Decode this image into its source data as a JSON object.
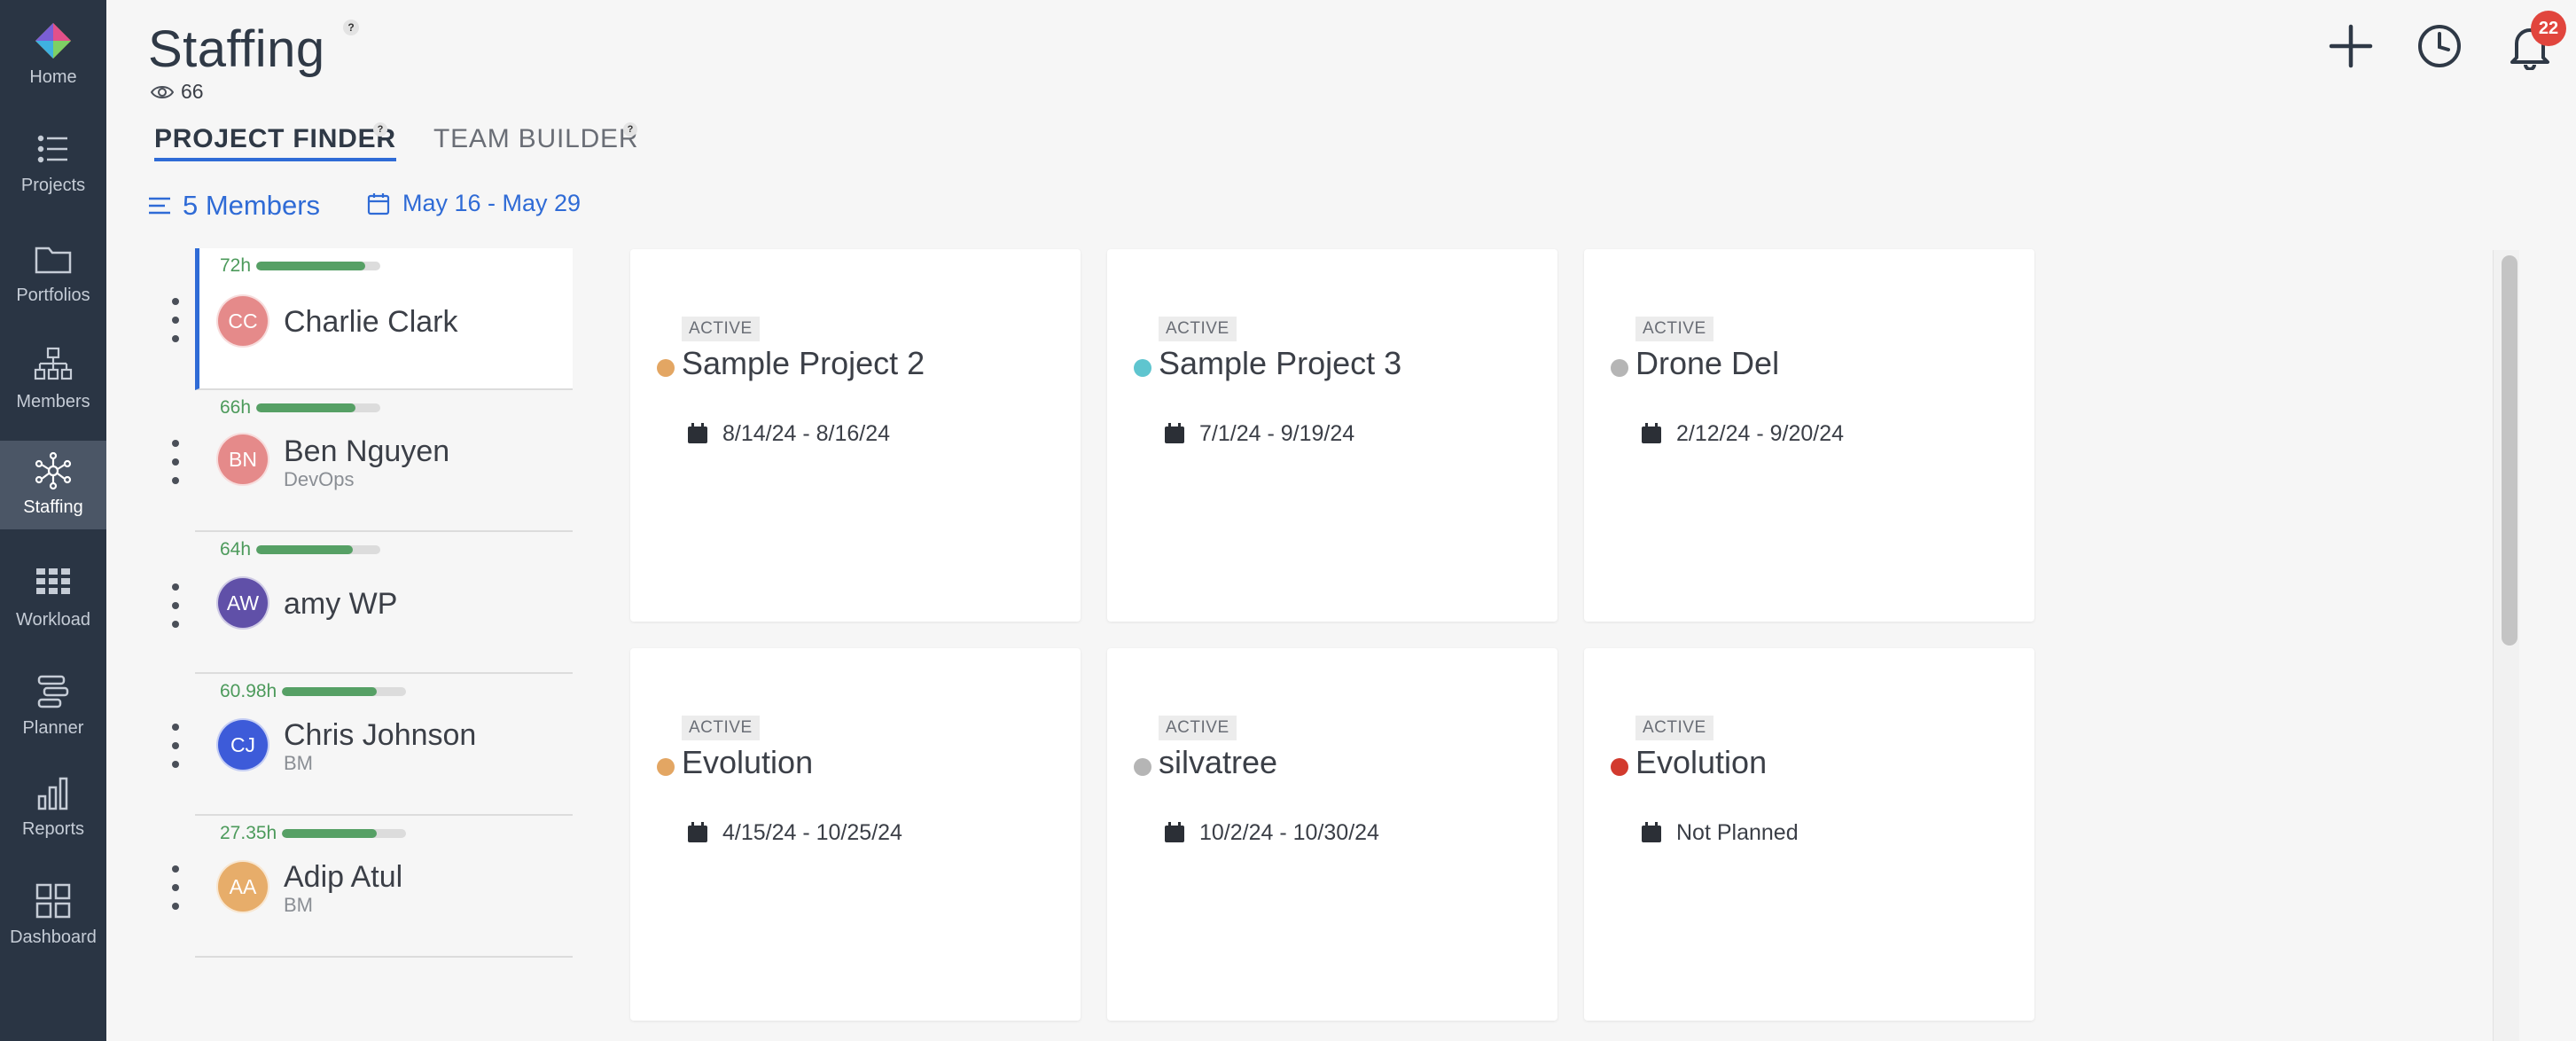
{
  "nav": {
    "items": [
      {
        "label": "Home",
        "icon": "home-logo-icon"
      },
      {
        "label": "Projects",
        "icon": "list-icon"
      },
      {
        "label": "Portfolios",
        "icon": "folder-icon"
      },
      {
        "label": "Members",
        "icon": "org-chart-icon"
      },
      {
        "label": "Staffing",
        "icon": "network-icon",
        "active": true
      },
      {
        "label": "Workload",
        "icon": "grid-icon"
      },
      {
        "label": "Planner",
        "icon": "planner-icon"
      },
      {
        "label": "Reports",
        "icon": "bar-chart-icon"
      },
      {
        "label": "Dashboard",
        "icon": "dashboard-icon"
      }
    ]
  },
  "header": {
    "title": "Staffing",
    "help": "?",
    "views_count": "66",
    "notification_count": "22"
  },
  "tabs": [
    {
      "label": "PROJECT FINDER",
      "help": "?",
      "active": true
    },
    {
      "label": "TEAM BUILDER",
      "help": "?",
      "active": false
    }
  ],
  "filters": {
    "members_label": "5 Members",
    "date_range": "May 16 - May 29"
  },
  "members": [
    {
      "initials": "CC",
      "name": "Charlie Clark",
      "role": "",
      "hours": "72h",
      "fill": 0.88,
      "avatar_color": "#e58a8a",
      "selected": true
    },
    {
      "initials": "BN",
      "name": "Ben Nguyen",
      "role": "DevOps",
      "hours": "66h",
      "fill": 0.8,
      "avatar_color": "#e58a8a",
      "selected": false
    },
    {
      "initials": "AW",
      "name": "amy WP",
      "role": "",
      "hours": "64h",
      "fill": 0.78,
      "avatar_color": "#6050a8",
      "selected": false
    },
    {
      "initials": "CJ",
      "name": "Chris Johnson",
      "role": "BM",
      "hours": "60.98h",
      "fill": 0.76,
      "avatar_color": "#3d5bd9",
      "selected": false
    },
    {
      "initials": "AA",
      "name": "Adip Atul",
      "role": "BM",
      "hours": "27.35h",
      "fill": 0.76,
      "avatar_color": "#e7ad6a",
      "selected": false
    }
  ],
  "projects": [
    {
      "status": "ACTIVE",
      "name": "Sample Project 2",
      "dates": "8/14/24 - 8/16/24",
      "dot_color": "#e3a663"
    },
    {
      "status": "ACTIVE",
      "name": "Sample Project 3",
      "dates": "7/1/24 - 9/19/24",
      "dot_color": "#5fc5cf"
    },
    {
      "status": "ACTIVE",
      "name": "Drone Del",
      "dates": "2/12/24 - 9/20/24",
      "dot_color": "#b5b5b5"
    },
    {
      "status": "ACTIVE",
      "name": "Evolution",
      "dates": "4/15/24 - 10/25/24",
      "dot_color": "#e3a663"
    },
    {
      "status": "ACTIVE",
      "name": "silvatree",
      "dates": "10/2/24 - 10/30/24",
      "dot_color": "#b5b5b5"
    },
    {
      "status": "ACTIVE",
      "name": "Evolution",
      "dates": "Not Planned",
      "dot_color": "#d23a2e"
    }
  ],
  "colors": {
    "accent": "#2f6bd6",
    "nav_bg": "#2a3544",
    "hours_green": "#4c9a5b"
  }
}
